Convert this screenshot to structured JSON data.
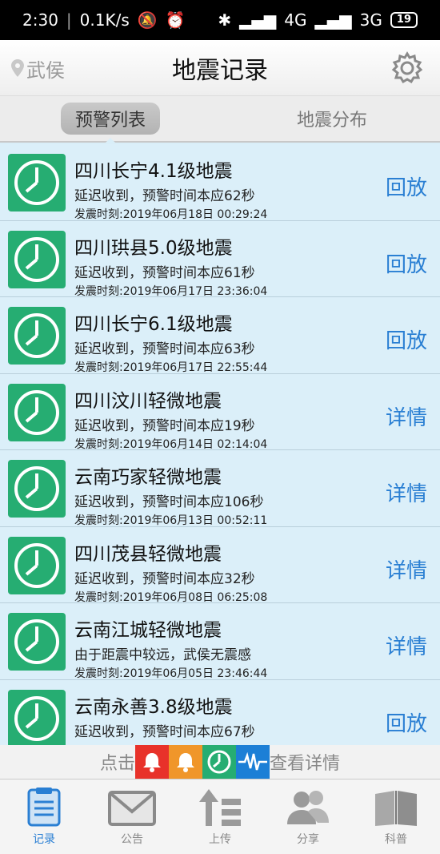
{
  "statusbar": {
    "time": "2:30",
    "speed": "0.1K/s",
    "network1": "4G",
    "network2": "3G",
    "battery": "19"
  },
  "header": {
    "location": "武侯",
    "title": "地震记录"
  },
  "tabs": [
    {
      "label": "预警列表"
    },
    {
      "label": "地震分布"
    }
  ],
  "list": [
    {
      "name": "四川长宁4.1级地震",
      "desc": "延迟收到，预警时间本应62秒",
      "time": "发震时刻:2019年06月18日 00:29:24",
      "action": "回放"
    },
    {
      "name": "四川珙县5.0级地震",
      "desc": "延迟收到，预警时间本应61秒",
      "time": "发震时刻:2019年06月17日 23:36:04",
      "action": "回放"
    },
    {
      "name": "四川长宁6.1级地震",
      "desc": "延迟收到，预警时间本应63秒",
      "time": "发震时刻:2019年06月17日 22:55:44",
      "action": "回放"
    },
    {
      "name": "四川汶川轻微地震",
      "desc": "延迟收到，预警时间本应19秒",
      "time": "发震时刻:2019年06月14日 02:14:04",
      "action": "详情"
    },
    {
      "name": "云南巧家轻微地震",
      "desc": "延迟收到，预警时间本应106秒",
      "time": "发震时刻:2019年06月13日 00:52:11",
      "action": "详情"
    },
    {
      "name": "四川茂县轻微地震",
      "desc": "延迟收到，预警时间本应32秒",
      "time": "发震时刻:2019年06月08日 06:25:08",
      "action": "详情"
    },
    {
      "name": "云南江城轻微地震",
      "desc": "由于距震中较远，武侯无震感",
      "time": "发震时刻:2019年06月05日 23:46:44",
      "action": "详情"
    },
    {
      "name": "云南永善3.8级地震",
      "desc": "延迟收到，预警时间本应67秒",
      "time": "",
      "action": "回放"
    }
  ],
  "hint": {
    "prefix": "点击",
    "suffix": "查看详情"
  },
  "tabbar": [
    {
      "label": "记录",
      "icon": "document-icon",
      "active": true
    },
    {
      "label": "公告",
      "icon": "mail-icon"
    },
    {
      "label": "上传",
      "icon": "upload-icon"
    },
    {
      "label": "分享",
      "icon": "people-icon"
    },
    {
      "label": "科普",
      "icon": "book-icon"
    }
  ],
  "colors": {
    "accent": "#2a7fd3",
    "clock": "#26ad72",
    "row_bg": "#dbeff9",
    "bell_red": "#e8322a",
    "bell_orange": "#f0962a",
    "wave_blue": "#1c7fd6"
  }
}
